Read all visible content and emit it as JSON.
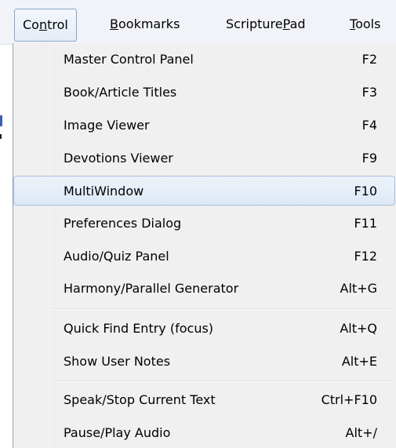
{
  "menubar": {
    "items": [
      {
        "label": "Control",
        "accel_index": 2,
        "active": true
      },
      {
        "label": "Bookmarks",
        "accel_index": 0,
        "active": false
      },
      {
        "label": "ScripturePad",
        "accel_index": 9,
        "active": false
      },
      {
        "label": "Tools",
        "accel_index": 0,
        "active": false
      }
    ]
  },
  "control_menu": {
    "items": [
      {
        "label": "Master Control Panel",
        "shortcut": "F2"
      },
      {
        "label": "Book/Article Titles",
        "shortcut": "F3"
      },
      {
        "label": "Image Viewer",
        "shortcut": "F4"
      },
      {
        "label": "Devotions Viewer",
        "shortcut": "F9"
      },
      {
        "label": "MultiWindow",
        "shortcut": "F10",
        "highlighted": true
      },
      {
        "label": "Preferences Dialog",
        "shortcut": "F11"
      },
      {
        "label": "Audio/Quiz Panel",
        "shortcut": "F12"
      },
      {
        "label": "Harmony/Parallel Generator",
        "shortcut": "Alt+G"
      },
      {
        "label": "Quick Find Entry (focus)",
        "shortcut": "Alt+Q"
      },
      {
        "label": "Show User Notes",
        "shortcut": "Alt+E"
      },
      {
        "label": "Speak/Stop Current Text",
        "shortcut": "Ctrl+F10"
      },
      {
        "label": "Pause/Play Audio",
        "shortcut": "Alt+/"
      }
    ]
  },
  "colors": {
    "highlight": "#dde8f6",
    "menu_background": "#f0f0f0",
    "menubar_background": "#f1f3f8"
  }
}
